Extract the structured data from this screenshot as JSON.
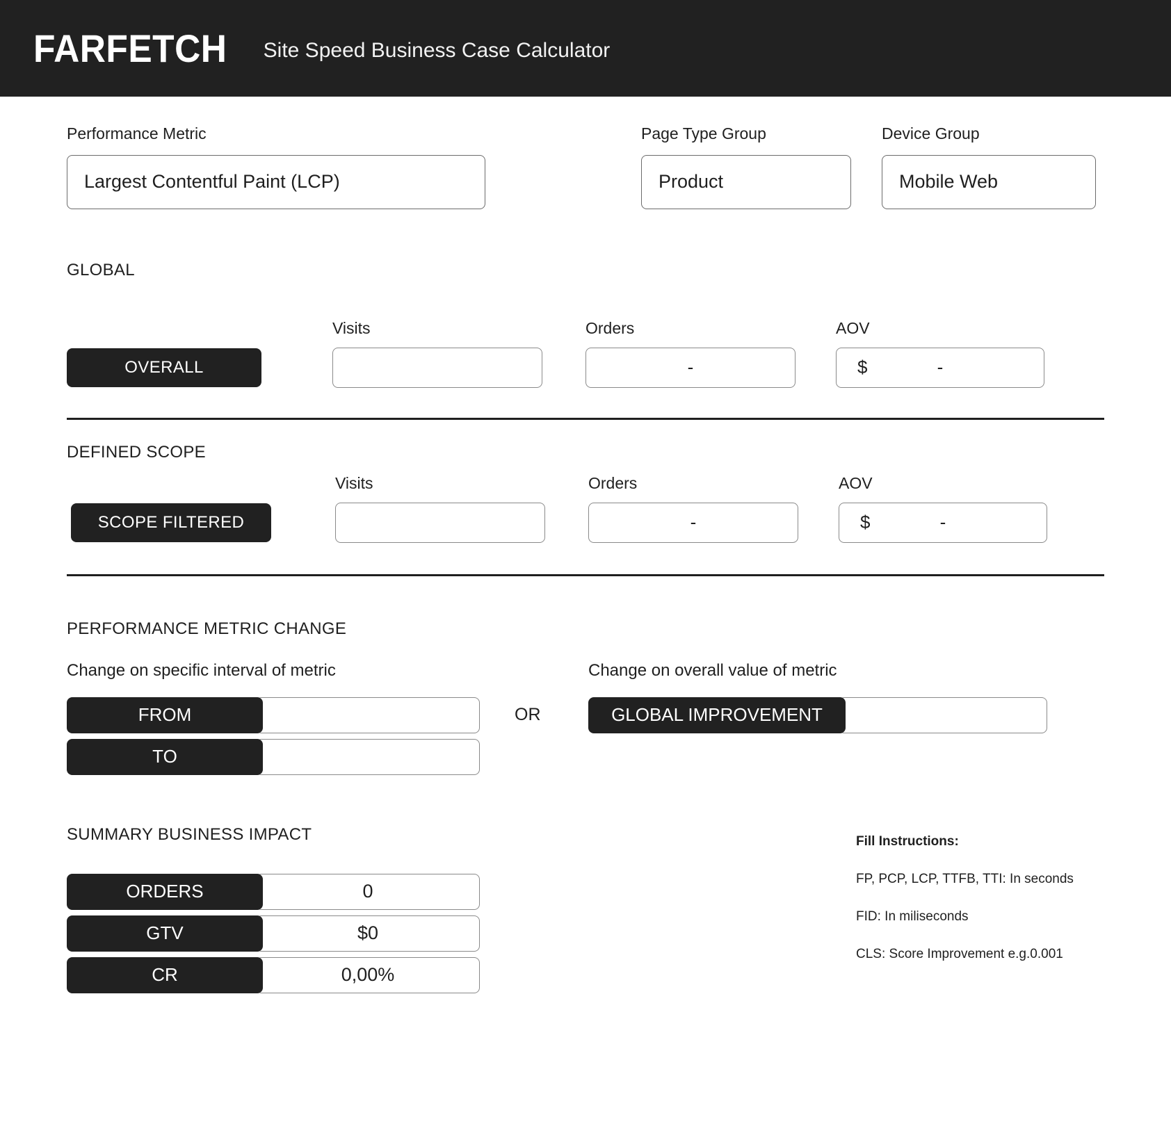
{
  "header": {
    "brand": "FARFETCH",
    "subtitle": "Site Speed Business Case Calculator"
  },
  "selectors": {
    "metric": {
      "label": "Performance Metric",
      "value": "Largest Contentful Paint (LCP)"
    },
    "page_type": {
      "label": "Page Type Group",
      "value": "Product"
    },
    "device": {
      "label": "Device Group",
      "value": "Mobile Web"
    }
  },
  "global": {
    "title": "GLOBAL",
    "headers": {
      "visits": "Visits",
      "orders": "Orders",
      "aov": "AOV"
    },
    "row_label": "OVERALL",
    "visits_value": "",
    "orders_value": "-",
    "aov_currency": "$",
    "aov_value": "-"
  },
  "defined_scope": {
    "title": "DEFINED SCOPE",
    "headers": {
      "visits": "Visits",
      "orders": "Orders",
      "aov": "AOV"
    },
    "row_label": "SCOPE FILTERED",
    "visits_value": "",
    "orders_value": "-",
    "aov_currency": "$",
    "aov_value": "-"
  },
  "performance_metric_change": {
    "title": "PERFORMANCE METRIC CHANGE",
    "left_label": "Change on specific interval of metric",
    "right_label": "Change on overall value of metric",
    "from_label": "FROM",
    "from_value": "",
    "to_label": "TO",
    "to_value": "",
    "or_text": "OR",
    "global_improvement_label": "GLOBAL IMPROVEMENT",
    "global_improvement_value": ""
  },
  "summary": {
    "title": "SUMMARY BUSINESS IMPACT",
    "rows": [
      {
        "label": "ORDERS",
        "value": "0"
      },
      {
        "label": "GTV",
        "value": "$0"
      },
      {
        "label": "CR",
        "value": "0,00%"
      }
    ]
  },
  "instructions": {
    "title": "Fill Instructions:",
    "lines": [
      "FP, PCP, LCP, TTFB, TTI: In seconds",
      "FID: In miliseconds",
      "CLS: Score Improvement e.g.0.001"
    ]
  },
  "colors": {
    "header_bg": "#212121",
    "pill_bg": "#212121",
    "page_bg": "#ffffff",
    "border": "#8a8a8a",
    "text": "#1f1f1f"
  }
}
